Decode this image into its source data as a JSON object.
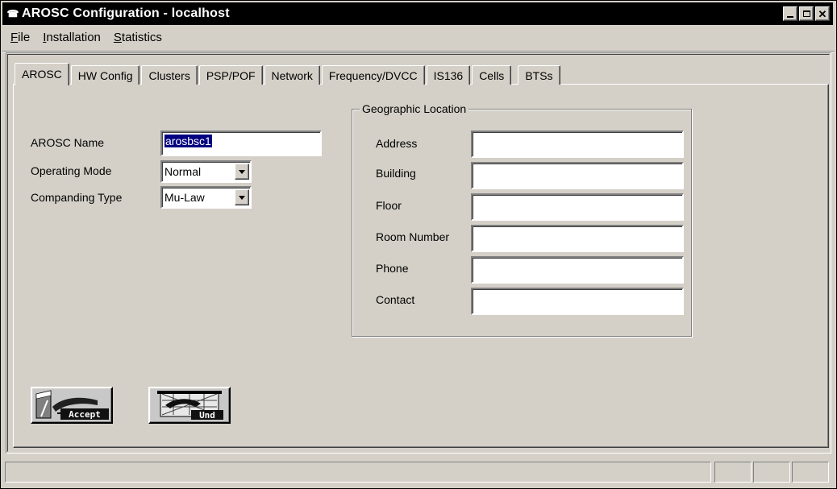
{
  "window": {
    "title": "AROSC Configuration - localhost",
    "app_icon": "phone-icon",
    "controls": [
      "minimize",
      "maximize",
      "close"
    ],
    "close_glyph": "✕"
  },
  "menu": [
    {
      "underline": "F",
      "rest": "ile"
    },
    {
      "underline": "I",
      "rest": "nstallation"
    },
    {
      "underline": "S",
      "rest": "tatistics"
    }
  ],
  "tabs": [
    "AROSC",
    "HW Config",
    "Clusters",
    "PSP/POF",
    "Network",
    "Frequency/DVCC",
    "IS136",
    "Cells",
    "BTSs"
  ],
  "active_tab": "AROSC",
  "form": {
    "name_label": "AROSC Name",
    "name_value": "arosbsc1",
    "mode_label": "Operating Mode",
    "mode_value": "Normal",
    "companding_label": "Companding Type",
    "companding_value": "Mu-Law"
  },
  "geo": {
    "legend": "Geographic Location",
    "fields": [
      {
        "label": "Address",
        "value": ""
      },
      {
        "label": "Building",
        "value": ""
      },
      {
        "label": "Floor",
        "value": ""
      },
      {
        "label": "Room Number",
        "value": ""
      },
      {
        "label": "Phone",
        "value": ""
      },
      {
        "label": "Contact",
        "value": ""
      }
    ]
  },
  "buttons": {
    "accept_label": "Accept",
    "undo_label": "Und"
  },
  "colors": {
    "title_bg": "#000000",
    "face": "#d4d0c8",
    "selection": "#000080"
  }
}
